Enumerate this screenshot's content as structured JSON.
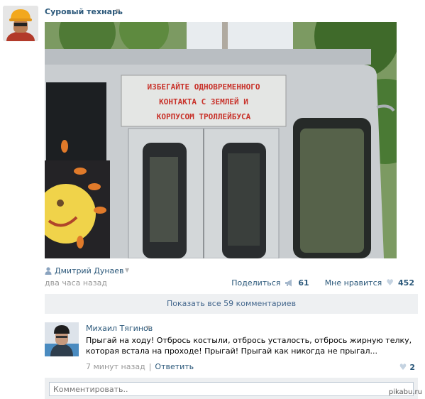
{
  "post": {
    "author": "Суровый технарь",
    "photo_sign_text": "ИЗБЕГАЙТЕ ОДНОВРЕМЕННОГО КОНТАКТА С ЗЕМЛЕЙ И КОРПУСОМ ТРОЛЛЕЙБУСА",
    "signer": "Дмитрий Дунаев",
    "date": "два часа назад",
    "share_label": "Поделиться",
    "share_count": "61",
    "like_label": "Мне нравится",
    "like_count": "452",
    "show_all_comments": "Показать все 59 комментариев"
  },
  "comment": {
    "author": "Михаил Тягинов",
    "text": "Прыгай на ходу! Отбрось костыли, отбрось усталость, отбрось жирную телку, которая встала на проходе! Прыгай! Прыгай как никогда не прыгал...",
    "time": "7 минут назад",
    "separator": "|",
    "reply_label": "Ответить",
    "like_count": "2"
  },
  "compose": {
    "placeholder": "Комментировать.."
  },
  "watermark": "pikabu.ru",
  "icons": {
    "dropdown": "dropdown-arrow-icon",
    "person": "person-icon",
    "megaphone": "megaphone-icon",
    "heart": "heart-icon"
  },
  "colors": {
    "link": "#2b587a",
    "muted": "#999999",
    "bar": "#eef0f2"
  }
}
